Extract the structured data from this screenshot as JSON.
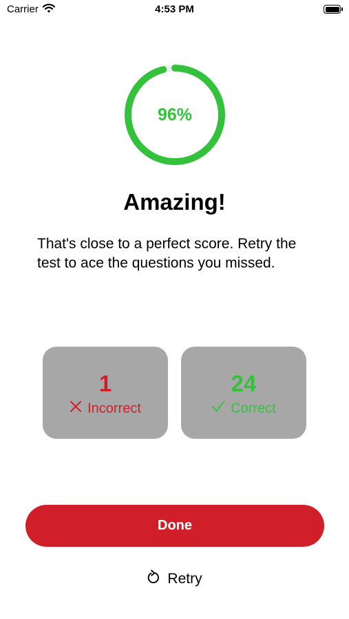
{
  "status_bar": {
    "carrier": "Carrier",
    "time": "4:53 PM"
  },
  "score": {
    "percent_label": "96%",
    "percent_value": 96,
    "ring_color": "#34c23d"
  },
  "result": {
    "headline": "Amazing!",
    "message": "That's close to a perfect score. Retry the test to ace the questions you missed."
  },
  "cards": {
    "incorrect": {
      "count": "1",
      "label": "Incorrect",
      "icon": "x-icon",
      "color": "#d11f2a"
    },
    "correct": {
      "count": "24",
      "label": "Correct",
      "icon": "checkmark-icon",
      "color": "#34c23d"
    }
  },
  "actions": {
    "done_label": "Done",
    "retry_label": "Retry",
    "retry_icon": "retry-arrow-icon"
  },
  "colors": {
    "accent": "#d11f2a",
    "card_background": "#a7a7a7"
  }
}
